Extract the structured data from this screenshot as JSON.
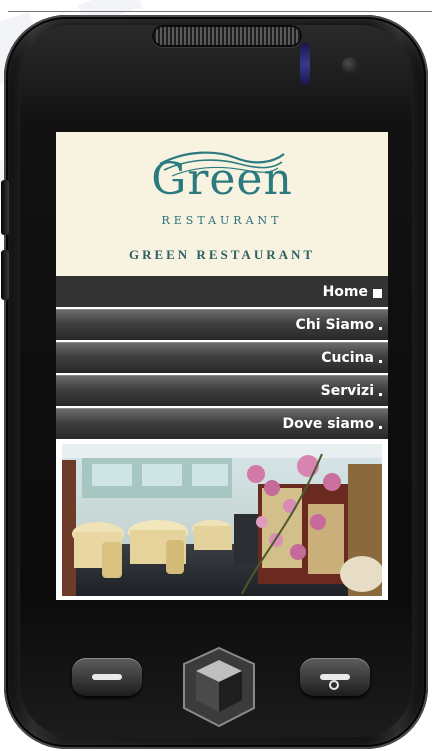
{
  "header": {
    "logo_word": "Green",
    "logo_sub": "RESTAURANT",
    "site_title": "GREEN RESTAURANT"
  },
  "nav": {
    "items": [
      {
        "label": "Home",
        "active": true
      },
      {
        "label": "Chi Siamo",
        "active": false
      },
      {
        "label": "Cucina",
        "active": false
      },
      {
        "label": "Servizi",
        "active": false
      },
      {
        "label": "Dove siamo",
        "active": false
      }
    ]
  },
  "icons": {
    "home_key": "cube-icon",
    "call_key": "call-icon",
    "end_key": "end-call-icon"
  },
  "colors": {
    "logo_teal": "#2a7a7f",
    "header_bg": "#f7f3e0",
    "nav_dark": "#333333"
  }
}
